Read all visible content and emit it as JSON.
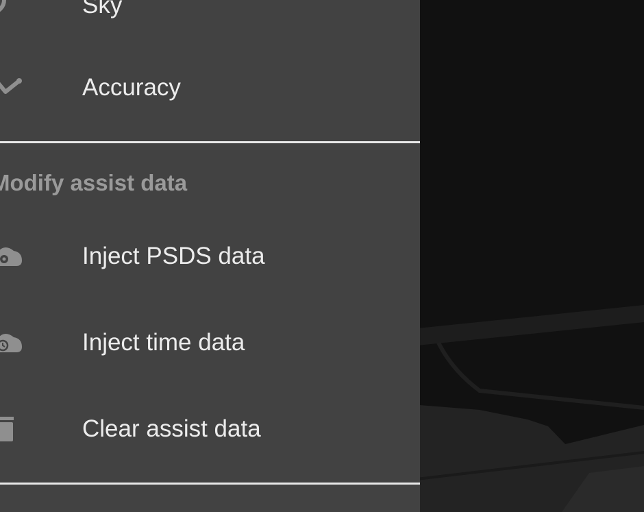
{
  "menu": {
    "top_items": [
      {
        "label": "Sky",
        "icon": "sky-icon"
      },
      {
        "label": "Accuracy",
        "icon": "accuracy-icon"
      }
    ],
    "section_header": "Modify assist data",
    "assist_items": [
      {
        "label": "Inject PSDS data",
        "icon": "cloud-gear-icon"
      },
      {
        "label": "Inject time data",
        "icon": "cloud-clock-icon"
      },
      {
        "label": "Clear assist data",
        "icon": "trash-icon"
      }
    ]
  },
  "colors": {
    "drawer_bg": "#424242",
    "label_text": "#ececec",
    "section_header_text": "#9a9a9a",
    "divider": "#e8e8e8",
    "icon": "#8f8f8f",
    "backdrop": "#121212"
  }
}
